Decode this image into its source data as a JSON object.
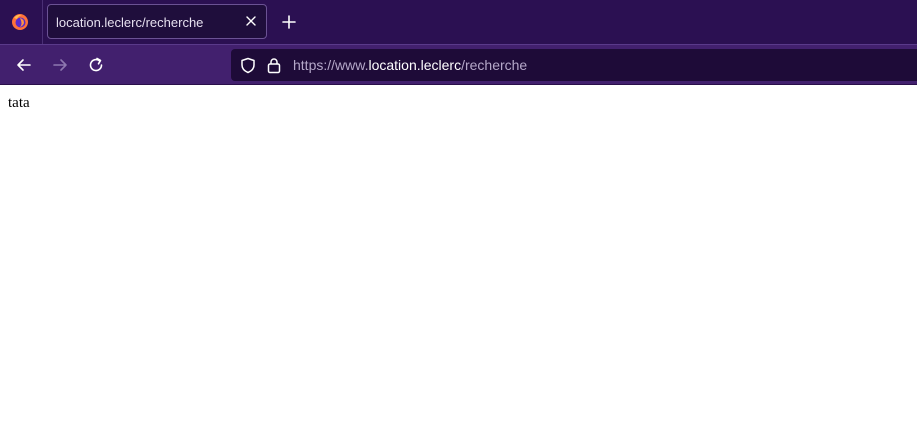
{
  "browser": {
    "tab": {
      "title": "location.leclerc/recherche"
    },
    "urlbar": {
      "scheme_prefix": "https://www.",
      "host": "location.leclerc",
      "path": "/recherche"
    }
  },
  "page": {
    "body_text": "tata"
  },
  "colors": {
    "tabstrip_bg": "#2b1052",
    "toolbar_bg": "#42206e",
    "urlbar_bg": "#1e0b38",
    "icon_color": "#ffffff"
  },
  "icons": {
    "app": "firefox-icon",
    "tab_close": "close-icon",
    "new_tab": "plus-icon",
    "back": "arrow-left-icon",
    "forward": "arrow-right-icon",
    "reload": "reload-icon",
    "tracking": "shield-icon",
    "security": "lock-icon"
  }
}
